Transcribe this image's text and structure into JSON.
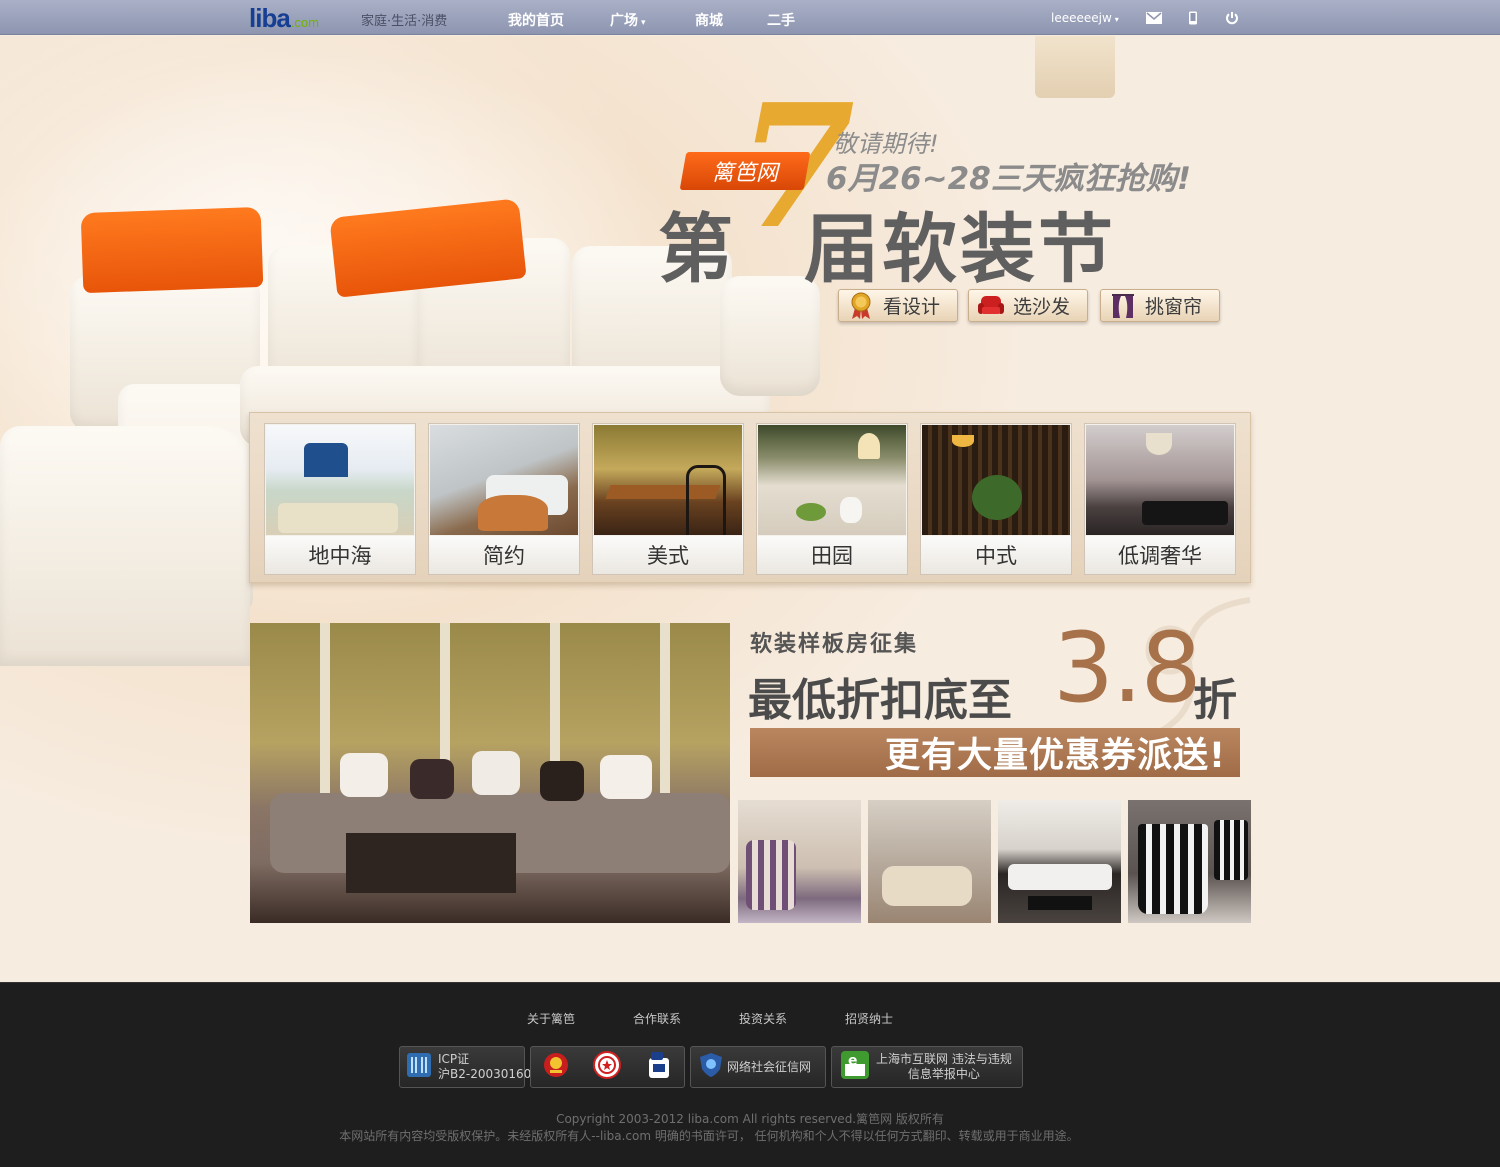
{
  "header": {
    "logo_text": "liba",
    "logo_suffix": ".com",
    "slogan": "家庭·生活·消费",
    "nav": [
      {
        "label": "我的首页"
      },
      {
        "label": "广场"
      },
      {
        "label": "商城"
      },
      {
        "label": "二手"
      }
    ],
    "username": "leeeeeejw",
    "icons": [
      "mail-icon",
      "mobile-icon",
      "power-icon"
    ]
  },
  "hero": {
    "sub_line1": "敬请期待!",
    "sub_line2": "6月26~28三天疯狂抢购!",
    "tag": "篱笆网",
    "big_number": "7",
    "title_part1": "第",
    "title_part2": "届软装节",
    "buttons": [
      {
        "label": "看设计",
        "icon": "medal-icon"
      },
      {
        "label": "选沙发",
        "icon": "sofa-icon"
      },
      {
        "label": "挑窗帘",
        "icon": "curtain-icon"
      }
    ]
  },
  "gallery": {
    "styles": [
      {
        "label": "地中海"
      },
      {
        "label": "简约"
      },
      {
        "label": "美式"
      },
      {
        "label": "田园"
      },
      {
        "label": "中式"
      },
      {
        "label": "低调奢华"
      }
    ]
  },
  "promo": {
    "subtitle": "软装样板房征集",
    "main_prefix": "最低折扣底至",
    "discount": "3.8",
    "main_suffix": "折",
    "bar_text": "更有大量优惠券派送!"
  },
  "footer": {
    "links": [
      {
        "label": "关于篱笆"
      },
      {
        "label": "合作联系"
      },
      {
        "label": "投资关系"
      },
      {
        "label": "招贤纳士"
      }
    ],
    "badges": {
      "icp_line1": "ICP证",
      "icp_line2": "沪B2-20030160",
      "credit": "网络社会征信网",
      "report_line1": "上海市互联网 违法与违规",
      "report_line2": "信息举报中心"
    },
    "copyright": "Copyright 2003-2012 liba.com All rights reserved.篱笆网 版权所有",
    "notice": "本网站所有内容均受版权保护。未经版权所有人--liba.com 明确的书面许可， 任何机构和个人不得以任何方式翻印、转载或用于商业用途。"
  },
  "colors": {
    "topbar": "#9aa1ba",
    "accent_orange": "#e8550a",
    "promo_brown": "#a7714a",
    "footer_bg": "#1e1e1e"
  }
}
